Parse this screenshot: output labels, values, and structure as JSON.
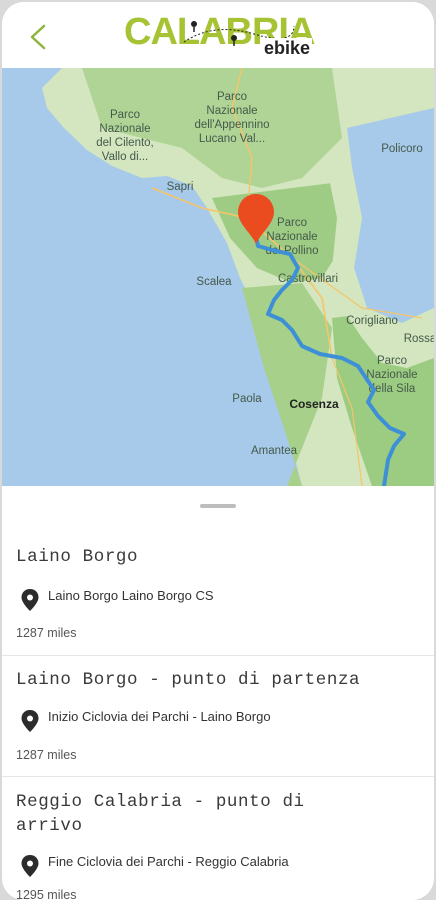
{
  "header": {
    "back_icon": "chevron-left-icon",
    "logo_main": "CALABRIA",
    "logo_sub": "ebike",
    "accent_color": "#a6c334"
  },
  "map": {
    "labels": {
      "parco_cilento_1": "Parco",
      "parco_cilento_2": "Nazionale",
      "parco_cilento_3": "del Cilento,",
      "parco_cilento_4": "Vallo di...",
      "parco_appennino_1": "Parco",
      "parco_appennino_2": "Nazionale",
      "parco_appennino_3": "dell'Appennino",
      "parco_appennino_4": "Lucano Val...",
      "policoro": "Policoro",
      "sapri": "Sapri",
      "parco_pollino_1": "Parco",
      "parco_pollino_2": "Nazionale",
      "parco_pollino_3": "del Pollino",
      "scalea": "Scalea",
      "castrovillari": "Castrovillari",
      "corigliano": "Corigliano",
      "rossano": "Rossa",
      "parco_sila_1": "Parco",
      "parco_sila_2": "Nazionale",
      "parco_sila_3": "della Sila",
      "paola": "Paola",
      "cosenza": "Cosenza",
      "amantea": "Amantea"
    },
    "marker_color": "#ea4b1f",
    "route_color": "#3d8fd6"
  },
  "list": {
    "items": [
      {
        "title": "Laino Borgo",
        "address": "Laino Borgo Laino Borgo CS",
        "distance": "1287 miles"
      },
      {
        "title": "Laino Borgo - punto di partenza",
        "address": "Inizio Ciclovia dei Parchi - Laino Borgo",
        "distance": "1287 miles"
      },
      {
        "title_line1": "Reggio Calabria - punto di",
        "title_line2": "arrivo",
        "address": "Fine Ciclovia dei Parchi - Reggio Calabria",
        "distance": "1295 miles"
      }
    ]
  }
}
